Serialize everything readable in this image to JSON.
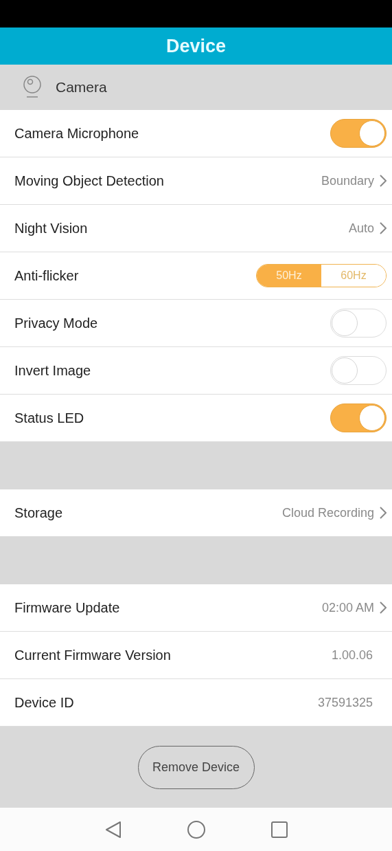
{
  "header": {
    "title": "Device"
  },
  "section": {
    "label": "Camera"
  },
  "groups": [
    {
      "items": [
        {
          "kind": "toggle",
          "label": "Camera Microphone",
          "on": true
        },
        {
          "kind": "link",
          "label": "Moving Object Detection",
          "value": "Boundary"
        },
        {
          "kind": "link",
          "label": "Night Vision",
          "value": "Auto"
        },
        {
          "kind": "segmented",
          "label": "Anti-flicker",
          "options": [
            {
              "label": "50Hz",
              "selected": true
            },
            {
              "label": "60Hz",
              "selected": false
            }
          ]
        },
        {
          "kind": "toggle",
          "label": "Privacy Mode",
          "on": false
        },
        {
          "kind": "toggle",
          "label": "Invert Image",
          "on": false
        },
        {
          "kind": "toggle",
          "label": "Status LED",
          "on": true
        }
      ]
    },
    {
      "items": [
        {
          "kind": "link",
          "label": "Storage",
          "value": "Cloud Recording"
        }
      ]
    },
    {
      "items": [
        {
          "kind": "link",
          "label": "Firmware Update",
          "value": "02:00 AM"
        },
        {
          "kind": "value",
          "label": "Current Firmware Version",
          "value": "1.00.06"
        },
        {
          "kind": "value",
          "label": "Device ID",
          "value": "37591325"
        }
      ]
    }
  ],
  "remove_button": "Remove Device"
}
